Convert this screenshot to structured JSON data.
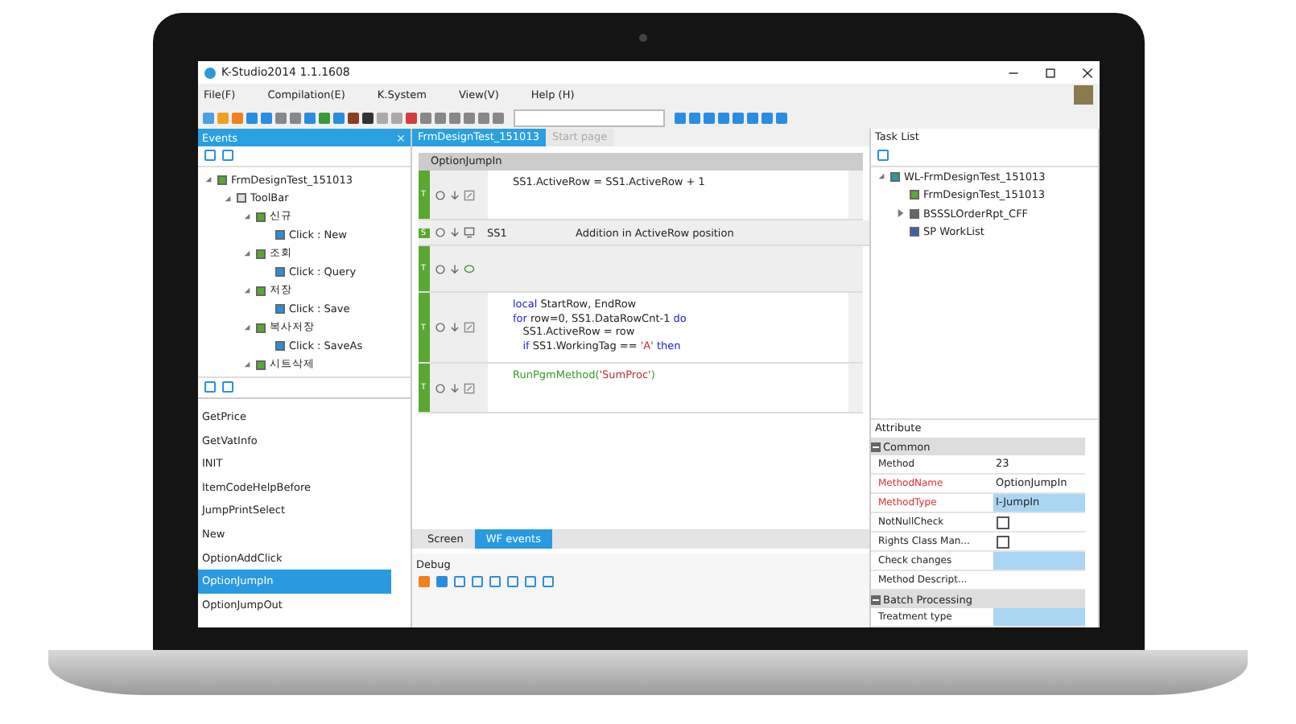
{
  "window": {
    "title": "K-Studio2014 1.1.1608"
  },
  "menu": [
    "File(F)",
    "Compilation(E)",
    "K.System",
    "View(V)",
    "Help (H)"
  ],
  "events_panel": {
    "title": "Events",
    "tree": [
      {
        "label": "FrmDesignTest_151013",
        "kind": "form",
        "expanded": true,
        "children": [
          {
            "label": "ToolBar",
            "kind": "toolbar",
            "expanded": true,
            "children": [
              {
                "label": "신규",
                "kind": "button",
                "expanded": true,
                "children": [
                  {
                    "label": "Click : New",
                    "kind": "event"
                  }
                ]
              },
              {
                "label": "조회",
                "kind": "button",
                "expanded": true,
                "children": [
                  {
                    "label": "Click : Query",
                    "kind": "event"
                  }
                ]
              },
              {
                "label": "저장",
                "kind": "button",
                "expanded": true,
                "children": [
                  {
                    "label": "Click : Save",
                    "kind": "event"
                  }
                ]
              },
              {
                "label": "복사저장",
                "kind": "button",
                "expanded": true,
                "children": [
                  {
                    "label": "Click : SaveAs",
                    "kind": "event"
                  }
                ]
              },
              {
                "label": "시트삭제",
                "kind": "button",
                "expanded": true
              }
            ]
          }
        ]
      }
    ]
  },
  "method_list": [
    {
      "label": "GetPrice",
      "selected": false
    },
    {
      "label": "GetVatInfo",
      "selected": false
    },
    {
      "label": "INIT",
      "selected": false
    },
    {
      "label": "ItemCodeHelpBefore",
      "selected": false
    },
    {
      "label": "JumpPrintSelect",
      "selected": false
    },
    {
      "label": "New",
      "selected": false
    },
    {
      "label": "OptionAddClick",
      "selected": false
    },
    {
      "label": "OptionJumpIn",
      "selected": true
    },
    {
      "label": "OptionJumpOut",
      "selected": false
    }
  ],
  "editor_tabs": [
    {
      "label": "FrmDesignTest_151013",
      "selected": true
    },
    {
      "label": "Start page",
      "selected": false
    }
  ],
  "method_header": "OptionJumpIn",
  "steps": [
    {
      "kind": "script",
      "badge": "T",
      "lines": [
        [
          {
            "text": "SS1.ActiveRow = SS1.ActiveRow + 1",
            "kind": "plain"
          }
        ]
      ]
    },
    {
      "kind": "screen",
      "badge": "S",
      "target": "SS1",
      "description": "Addition in ActiveRow position"
    },
    {
      "kind": "comment",
      "badge": "T"
    },
    {
      "kind": "script",
      "badge": "T",
      "lines": [
        [
          {
            "text": "local",
            "kind": "keyword"
          },
          {
            "text": " StartRow, EndRow",
            "kind": "plain"
          }
        ],
        [
          {
            "text": "for",
            "kind": "keyword"
          },
          {
            "text": " row=0, SS1.DataRowCnt-1 ",
            "kind": "plain"
          },
          {
            "text": "do",
            "kind": "keyword"
          }
        ],
        [
          {
            "text": "   SS1.ActiveRow = row",
            "kind": "plain"
          }
        ],
        [
          {
            "text": "   if",
            "kind": "keyword"
          },
          {
            "text": " SS1.WorkingTag == ",
            "kind": "plain"
          },
          {
            "text": "'A'",
            "kind": "string"
          },
          {
            "text": " then",
            "kind": "keyword"
          }
        ]
      ]
    },
    {
      "kind": "script",
      "badge": "T",
      "lines": [
        [
          {
            "text": "RunPgmMethod(",
            "kind": "call"
          },
          {
            "text": "'SumProc'",
            "kind": "string"
          },
          {
            "text": ")",
            "kind": "call"
          }
        ]
      ]
    }
  ],
  "bottom_tabs": [
    {
      "label": "Screen",
      "selected": false
    },
    {
      "label": "WF events",
      "selected": true
    }
  ],
  "debug_panel": {
    "title": "Debug"
  },
  "task_list": {
    "title": "Task List",
    "tree": [
      {
        "label": "WL-FrmDesignTest_151013",
        "kind": "workflow",
        "expanded": true,
        "children": [
          {
            "label": "FrmDesignTest_151013",
            "kind": "form"
          },
          {
            "label": "BSSSLOrderRpt_CFF",
            "kind": "report",
            "expanded": false
          },
          {
            "label": "SP WorkList",
            "kind": "sp"
          }
        ]
      }
    ]
  },
  "attribute_panel": {
    "title": "Attribute",
    "groups": [
      {
        "label": "Common",
        "expanded": true,
        "rows": [
          {
            "name": "Method",
            "value": "23",
            "required": false,
            "kind": "text"
          },
          {
            "name": "MethodName",
            "value": "OptionJumpIn",
            "required": true,
            "kind": "text"
          },
          {
            "name": "MethodType",
            "value": "I-JumpIn",
            "required": true,
            "kind": "highlight"
          },
          {
            "name": "NotNullCheck",
            "required": false,
            "kind": "checkbox",
            "checked": false
          },
          {
            "name": "Rights Class Man...",
            "required": false,
            "kind": "checkbox",
            "checked": false
          },
          {
            "name": "Check changes",
            "required": false,
            "kind": "highlight"
          },
          {
            "name": "Method Descript...",
            "required": false,
            "kind": "text"
          }
        ]
      },
      {
        "label": "Batch Processing",
        "expanded": true,
        "rows": [
          {
            "name": "Treatment type",
            "required": false,
            "kind": "highlight"
          }
        ]
      }
    ]
  }
}
